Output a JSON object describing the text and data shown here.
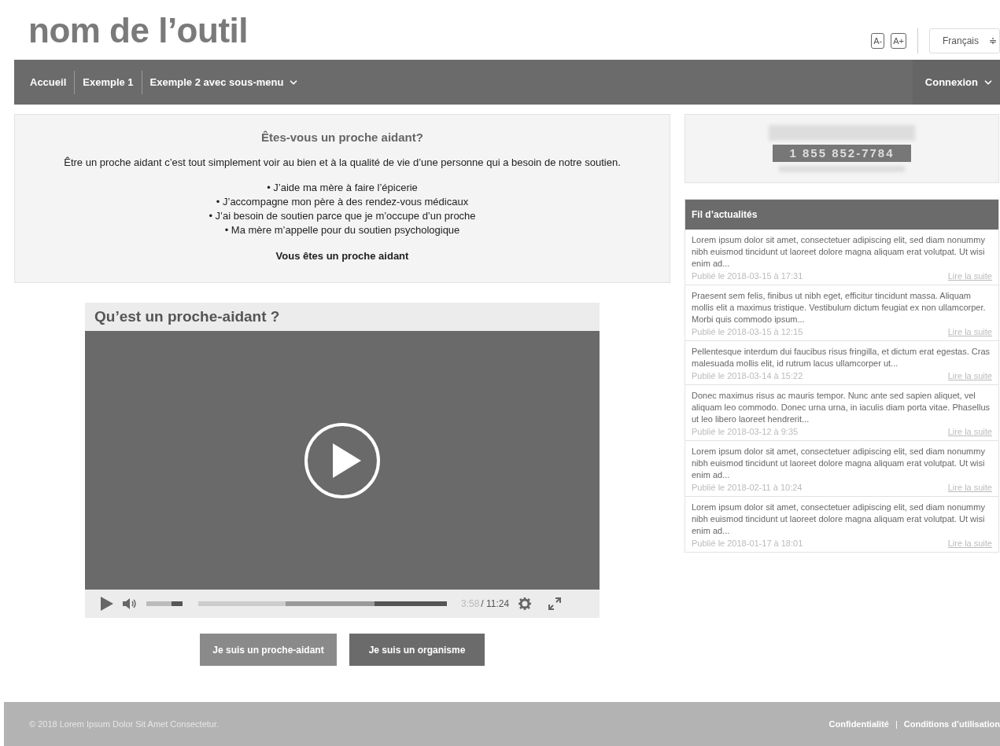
{
  "site_title": "nom de l’outil",
  "font_controls": [
    "A-",
    "A+"
  ],
  "language": {
    "value": "Français",
    "arrow": "≑"
  },
  "nav": {
    "items": [
      {
        "label": "Accueil",
        "has_submenu": false
      },
      {
        "label": "Exemple 1",
        "has_submenu": false
      },
      {
        "label": "Exemple 2 avec sous-menu",
        "has_submenu": true
      }
    ],
    "login": {
      "label": "Connexion",
      "has_submenu": true
    }
  },
  "intro": {
    "title": "Êtes-vous un proche aidant?",
    "text": "Être un proche aidant c’est tout simplement voir au bien et à la qualité de vie d’une personne qui a besoin de notre soutien.",
    "bullets": [
      "• J’aide ma mère à faire l’épicerie",
      "• J’accompagne mon père à des rendez-vous médicaux",
      "• J’ai besoin de soutien parce que je m’occupe d’un proche",
      "• Ma mère m’appelle pour du soutien psychologique"
    ],
    "conclusion": "Vous êtes un proche aidant"
  },
  "video": {
    "title": "Qu’est un proche-aidant ?",
    "volume": {
      "level": 0.7
    },
    "buffered": {
      "level": 0.71
    },
    "played": {
      "level": 0.35
    },
    "current_time": "3:58",
    "total_time": "/ 11:24"
  },
  "buttons": [
    {
      "label": "Je suis un proche-aidant",
      "selected": false
    },
    {
      "label": "Je suis un organisme",
      "selected": true
    }
  ],
  "banner": {
    "phone": "1 855 852-7784"
  },
  "news": {
    "title": "Fil d’actualités",
    "items": [
      {
        "text": "Lorem ipsum dolor sit amet, consectetuer adipiscing elit, sed diam nonummy nibh euismod tincidunt ut laoreet dolore magna aliquam erat volutpat. Ut wisi enim ad...",
        "date": "Publié le 2018-03-15 à 17:31",
        "link": "Lire la suite"
      },
      {
        "text": "Praesent sem felis, finibus ut nibh eget, efficitur tincidunt massa. Aliquam mollis elit a maximus tristique. Vestibulum dictum feugiat ex non ullamcorper. Morbi quis commodo ipsum...",
        "date": "Publié le 2018-03-15 à 12:15",
        "link": "Lire la suite"
      },
      {
        "text": "Pellentesque interdum dui faucibus risus fringilla, et dictum erat egestas. Cras malesuada mollis elit, id rutrum lacus ullamcorper ut...",
        "date": "Publié le 2018-03-14 à 15:22",
        "link": "Lire la suite"
      },
      {
        "text": "Donec maximus risus ac mauris tempor. Nunc ante sed sapien aliquet, vel aliquam leo commodo. Donec urna urna, in iaculis diam porta vitae. Phasellus ut leo libero laoreet hendrerit...",
        "date": "Publié le 2018-03-12 à 9:35",
        "link": "Lire la suite"
      },
      {
        "text": "Lorem ipsum dolor sit amet, consectetuer adipiscing elit, sed diam nonummy nibh euismod tincidunt ut laoreet dolore magna aliquam erat volutpat. Ut wisi enim ad...",
        "date": "Publié le 2018-02-11 à 10:24",
        "link": "Lire la suite"
      },
      {
        "text": "Lorem ipsum dolor sit amet, consectetuer adipiscing elit, sed diam nonummy nibh euismod tincidunt ut laoreet dolore magna aliquam erat volutpat. Ut wisi enim ad...",
        "date": "Publié le 2018-01-17 à 18:01",
        "link": "Lire la suite"
      }
    ]
  },
  "footer": {
    "copyright": "© 2018 Lorem Ipsum Dolor Sit Amet Consectetur.",
    "links": [
      "Confidentialité",
      "Conditions d’utilisation"
    ],
    "separator": "|"
  }
}
